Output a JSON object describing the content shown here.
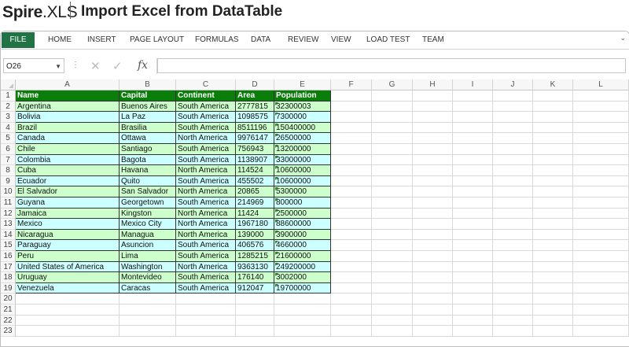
{
  "header": {
    "brand_bold": "Spire",
    "brand_rest": ".XLS",
    "title": "Import Excel from DataTable"
  },
  "ribbon": {
    "tabs": [
      "FILE",
      "HOME",
      "INSERT",
      "PAGE LAYOUT",
      "FORMULAS",
      "DATA",
      "REVIEW",
      "VIEW",
      "LOAD TEST",
      "TEAM"
    ]
  },
  "formula_bar": {
    "name_box": "O26",
    "formula": ""
  },
  "sheet": {
    "columns": [
      "A",
      "B",
      "C",
      "D",
      "E",
      "F",
      "G",
      "H",
      "I",
      "J",
      "K",
      "L"
    ],
    "row_numbers": [
      "1",
      "2",
      "3",
      "4",
      "5",
      "6",
      "7",
      "8",
      "9",
      "10",
      "11",
      "12",
      "13",
      "14",
      "15",
      "16",
      "17",
      "18",
      "19",
      "20",
      "21",
      "22",
      "23"
    ],
    "headers": [
      "Name",
      "Capital",
      "Continent",
      "Area",
      "Population"
    ],
    "rows": [
      [
        "Argentina",
        "Buenos Aires",
        "South America",
        "2777815",
        "32300003"
      ],
      [
        "Bolivia",
        "La Paz",
        "South America",
        "1098575",
        "7300000"
      ],
      [
        "Brazil",
        "Brasilia",
        "South America",
        "8511196",
        "150400000"
      ],
      [
        "Canada",
        "Ottawa",
        "North America",
        "9976147",
        "26500000"
      ],
      [
        "Chile",
        "Santiago",
        "South America",
        "756943",
        "13200000"
      ],
      [
        "Colombia",
        "Bagota",
        "South America",
        "1138907",
        "33000000"
      ],
      [
        "Cuba",
        "Havana",
        "North America",
        "114524",
        "10600000"
      ],
      [
        "Ecuador",
        "Quito",
        "South America",
        "455502",
        "10600000"
      ],
      [
        "El Salvador",
        "San Salvador",
        "North America",
        "20865",
        "5300000"
      ],
      [
        "Guyana",
        "Georgetown",
        "South America",
        "214969",
        "800000"
      ],
      [
        "Jamaica",
        "Kingston",
        "North America",
        "11424",
        "2500000"
      ],
      [
        "Mexico",
        "Mexico City",
        "North America",
        "1967180",
        "88600000"
      ],
      [
        "Nicaragua",
        "Managua",
        "North America",
        "139000",
        "3900000"
      ],
      [
        "Paraguay",
        "Asuncion",
        "South America",
        "406576",
        "4660000"
      ],
      [
        "Peru",
        "Lima",
        "South America",
        "1285215",
        "21600000"
      ],
      [
        "United States of America",
        "Washington",
        "North America",
        "9363130",
        "249200000"
      ],
      [
        "Uruguay",
        "Montevideo",
        "South America",
        "176140",
        "3002000"
      ],
      [
        "Venezuela",
        "Caracas",
        "South America",
        "912047",
        "19700000"
      ]
    ]
  },
  "colors": {
    "header_fill": "#0a7d0a",
    "row_cyan": "#ccffff",
    "row_green": "#ccffcc",
    "file_tab": "#217346"
  }
}
